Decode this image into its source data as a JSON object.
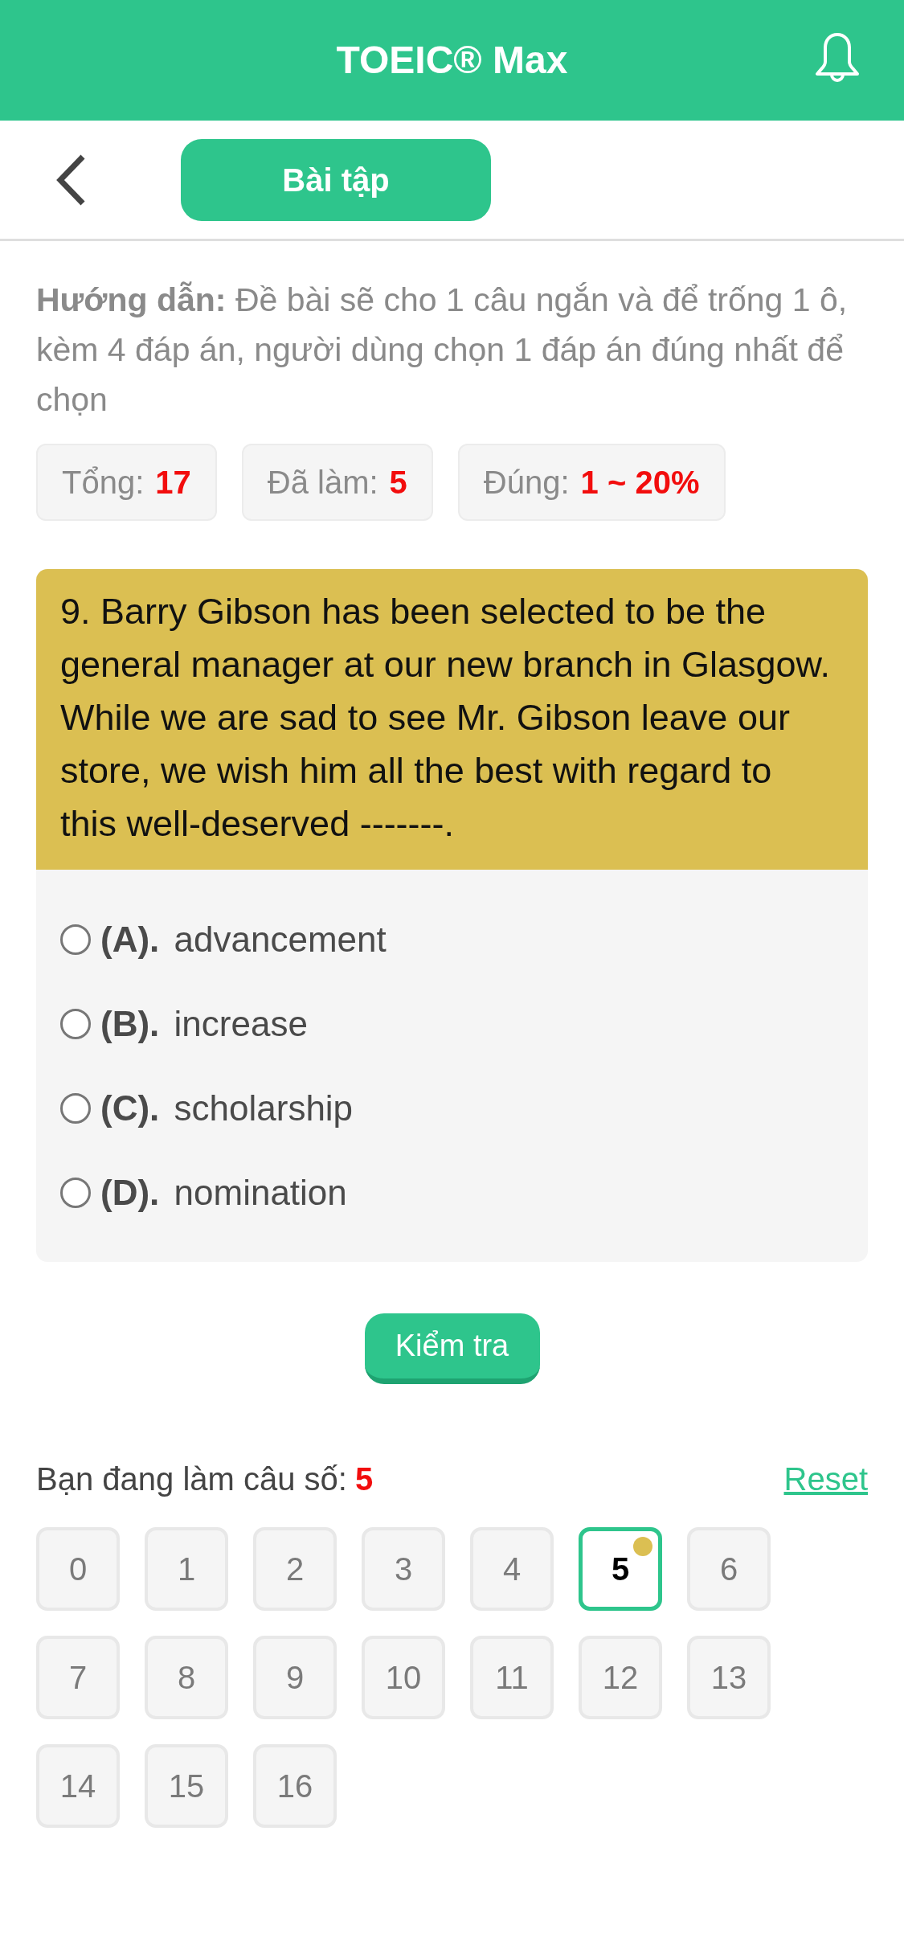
{
  "app_bar": {
    "title": "TOEIC® Max"
  },
  "toolbar": {
    "section_button": "Bài tập"
  },
  "instructions": "**Hướng dẫn:** Đề bài sẽ cho 1 câu ngắn và để trống 1 ô, kèm 4 đáp án, người dùng chọn 1 đáp án đúng nhất để chọn",
  "stats": [
    {
      "label": "Tổng:",
      "value": "17"
    },
    {
      "label": "Đã làm:",
      "value": "5"
    },
    {
      "label": "Đúng:",
      "value": "1 ~ 20%"
    }
  ],
  "question": {
    "text": "9. Barry Gibson has been selected to be the general manager at our new branch in Glasgow. While we are sad to see Mr. Gibson leave our store, we wish him all the best with regard to this well-deserved -------.",
    "options": [
      {
        "letter": "(A).",
        "text": "advancement",
        "selected": false
      },
      {
        "letter": "(B).",
        "text": "increase",
        "selected": false
      },
      {
        "letter": "(C).",
        "text": "scholarship",
        "selected": false
      },
      {
        "letter": "(D).",
        "text": "nomination",
        "selected": false
      }
    ]
  },
  "check_button": "Kiểm tra",
  "progress": {
    "label": "Bạn đang làm câu số:",
    "current": "5",
    "reset": "Reset"
  },
  "question_grid": [
    {
      "number": "0",
      "selected": false,
      "marked": false
    },
    {
      "number": "1",
      "selected": false,
      "marked": false
    },
    {
      "number": "2",
      "selected": false,
      "marked": false
    },
    {
      "number": "3",
      "selected": false,
      "marked": false
    },
    {
      "number": "4",
      "selected": false,
      "marked": false
    },
    {
      "number": "5",
      "selected": true,
      "marked": true
    },
    {
      "number": "6",
      "selected": false,
      "marked": false
    },
    {
      "number": "7",
      "selected": false,
      "marked": false
    },
    {
      "number": "8",
      "selected": false,
      "marked": false
    },
    {
      "number": "9",
      "selected": false,
      "marked": false
    },
    {
      "number": "10",
      "selected": false,
      "marked": false
    },
    {
      "number": "11",
      "selected": false,
      "marked": false
    },
    {
      "number": "12",
      "selected": false,
      "marked": false
    },
    {
      "number": "13",
      "selected": false,
      "marked": false
    },
    {
      "number": "14",
      "selected": false,
      "marked": false
    },
    {
      "number": "15",
      "selected": false,
      "marked": false
    },
    {
      "number": "16",
      "selected": false,
      "marked": false
    }
  ]
}
